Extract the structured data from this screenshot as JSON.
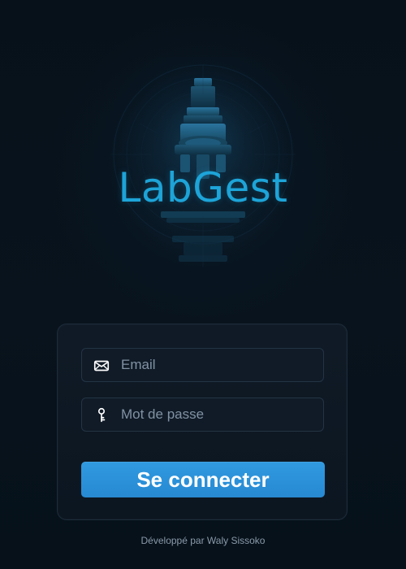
{
  "brand": {
    "title": "LabGest"
  },
  "login": {
    "email_placeholder": "Email",
    "password_placeholder": "Mot de passe",
    "submit_label": "Se connecter"
  },
  "footer": {
    "credit": "Développé par Waly Sissoko"
  },
  "icons": {
    "email": "envelope-icon",
    "password": "key-icon",
    "logo": "microscope-icon"
  },
  "colors": {
    "background": "#08121c",
    "brand": "#1da4d8",
    "button": "#2c91d8",
    "panel": "#101b27"
  }
}
